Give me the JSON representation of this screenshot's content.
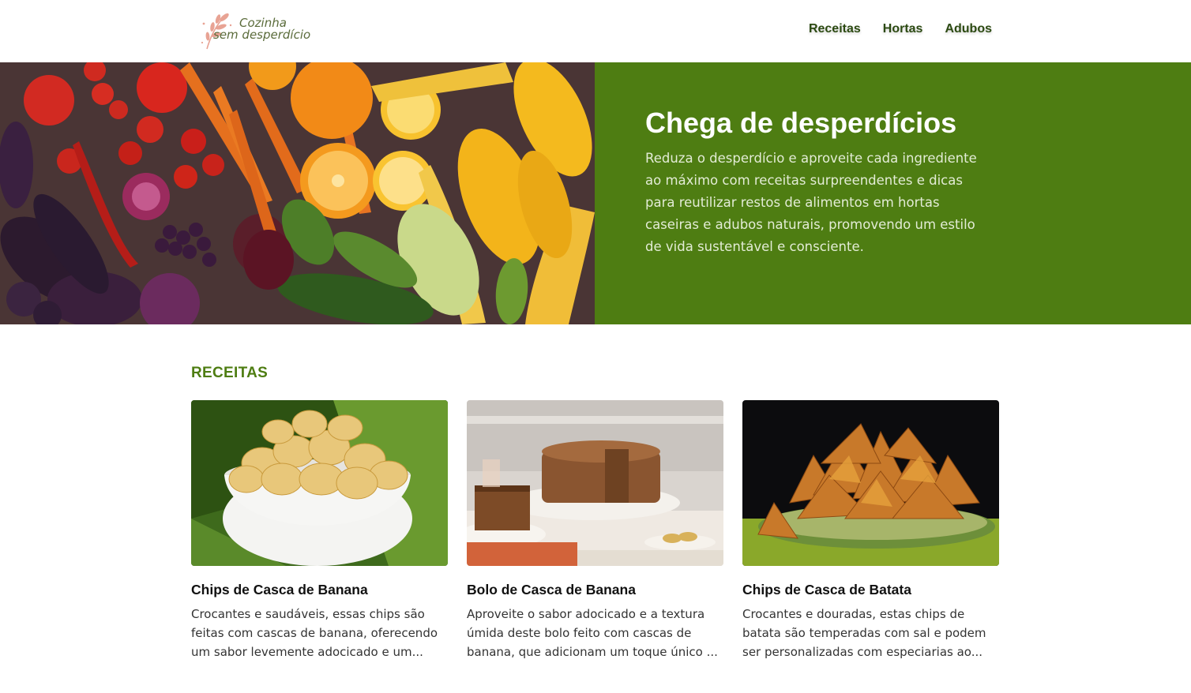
{
  "brand": {
    "line1": "Cozinha",
    "line2": "sem desperdício",
    "accent_color": "#e8a394"
  },
  "nav": {
    "items": [
      {
        "label": "Receitas"
      },
      {
        "label": "Hortas"
      },
      {
        "label": "Adubos"
      }
    ]
  },
  "hero": {
    "title": "Chega de desperdícios",
    "text": "Reduza o desperdício e aproveite cada ingrediente ao máximo com receitas surpreendentes e dicas para reutilizar restos de alimentos em hortas caseiras e adubos naturais, promovendo um estilo de vida sustentável e consciente.",
    "panel_color": "#4e7d12"
  },
  "recipes": {
    "section_title": "RECEITAS",
    "items": [
      {
        "title": "Chips de Casca de Banana",
        "description": "Crocantes e saudáveis, essas chips são feitas com cascas de banana, oferecendo um sabor levemente adocicado e um..."
      },
      {
        "title": "Bolo de Casca de Banana",
        "description": "Aproveite o sabor adocicado e a textura úmida deste bolo feito com cascas de banana, que adicionam um toque único ..."
      },
      {
        "title": "Chips de Casca de Batata",
        "description": "Crocantes e douradas, estas chips de batata são temperadas com sal e podem ser personalizadas com especiarias ao..."
      }
    ]
  }
}
